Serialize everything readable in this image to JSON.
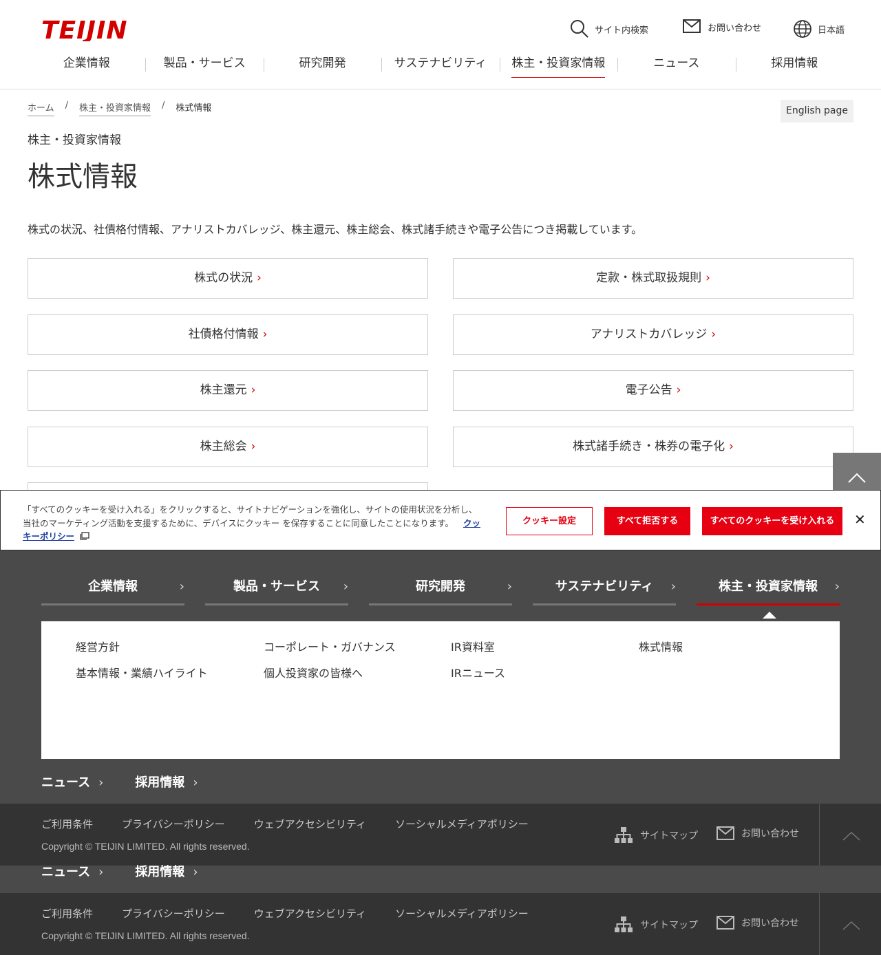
{
  "brand": {
    "logo_text": "TEIJIN",
    "accent": "#d40000"
  },
  "header": {
    "utilities": [
      {
        "label": "サイト内検索",
        "icon": "search-icon"
      },
      {
        "label": "お問い合わせ",
        "icon": "mail-icon"
      },
      {
        "label": "日本語",
        "icon": "globe-icon"
      }
    ],
    "nav": [
      "企業情報",
      "製品・サービス",
      "研究開発",
      "サステナビリティ",
      "株主・投資家情報",
      "ニュース",
      "採用情報"
    ],
    "nav_active": "株主・投資家情報"
  },
  "breadcrumb": {
    "home": "ホーム",
    "parent": "株主・投資家情報",
    "current": "株式情報",
    "sep": "/"
  },
  "english_page": "English page",
  "section_label": "株主・投資家情報",
  "page_title": "株式情報",
  "lead": "株式の状況、社債格付情報、アナリストカバレッジ、株主還元、株主総会、株式諸手続きや電子公告につき掲載しています。",
  "links": [
    "株式の状況",
    "定款・株式取扱規則",
    "社債格付情報",
    "アナリストカバレッジ",
    "株主還元",
    "電子公告",
    "株主総会",
    "株式諸手続き・株券の電子化"
  ],
  "cookie": {
    "text": "「すべてのクッキーを受け入れる」をクリックすると、サイトナビゲーションを強化し、サイトの使用状況を分析し、当社のマーケティング活動を支援するために、デバイスにクッキー を保存することに同意したことになります。",
    "policy_link": "クッキーポリシー",
    "settings": "クッキー設定",
    "reject": "すべて拒否する",
    "accept": "すべてのクッキーを受け入れる",
    "close": "✕"
  },
  "footer_nav": {
    "tabs": [
      "企業情報",
      "製品・サービス",
      "研究開発",
      "サステナビリティ",
      "株主・投資家情報"
    ],
    "active_tab": "株主・投資家情報",
    "panel_links": [
      "経営方針",
      "コーポレート・ガバナンス",
      "IR資料室",
      "株式情報",
      "基本情報・業績ハイライト",
      "個人投資家の皆様へ",
      "IRニュース"
    ],
    "bottom": [
      "ニュース",
      "採用情報"
    ]
  },
  "footer": {
    "links": [
      "ご利用条件",
      "プライバシーポリシー",
      "ウェブアクセシビリティ",
      "ソーシャルメディアポリシー"
    ],
    "copyright": "Copyright © TEIJIN LIMITED. All rights reserved.",
    "sitemap": "サイトマップ",
    "contact": "お問い合わせ"
  }
}
